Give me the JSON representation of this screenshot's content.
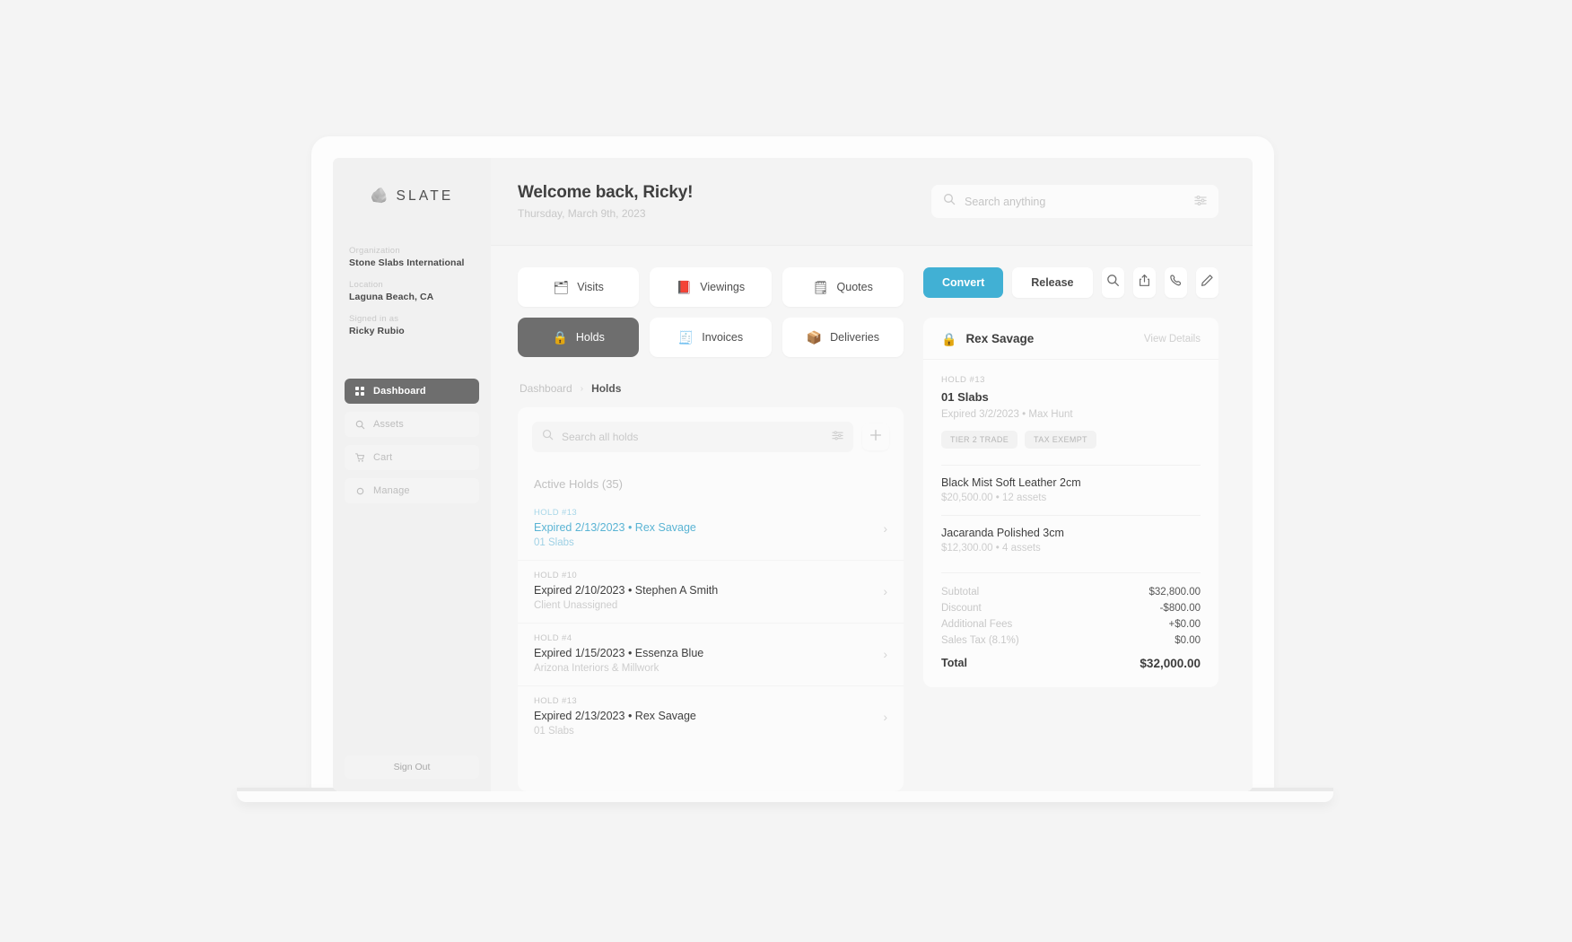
{
  "brand": {
    "mark": "🪨",
    "name": "SLATE"
  },
  "sidebar": {
    "org_label": "Organization",
    "org_value": "Stone Slabs International",
    "location_label": "Location",
    "location_value": "Laguna Beach, CA",
    "signedin_label": "Signed in as",
    "signedin_value": "Ricky Rubio",
    "nav": [
      {
        "label": "Dashboard",
        "icon": "grid-icon",
        "active": true
      },
      {
        "label": "Assets",
        "icon": "search-icon",
        "active": false
      },
      {
        "label": "Cart",
        "icon": "cart-icon",
        "active": false
      },
      {
        "label": "Manage",
        "icon": "gear-icon",
        "active": false
      }
    ],
    "sign_out": "Sign Out"
  },
  "topbar": {
    "title": "Welcome back, Ricky!",
    "subtitle": "Thursday, March 9th, 2023",
    "search_placeholder": "Search anything",
    "search_value": "",
    "filter_icon": "sliders-icon",
    "search_icon": "search-icon"
  },
  "chips": [
    {
      "label": "Visits",
      "emoji": "🗂",
      "active": false
    },
    {
      "label": "Viewings",
      "emoji": "📕",
      "active": false
    },
    {
      "label": "Quotes",
      "emoji": "🗒",
      "active": false
    },
    {
      "label": "Holds",
      "emoji": "🔒",
      "active": true
    },
    {
      "label": "Invoices",
      "emoji": "🧾",
      "active": false
    },
    {
      "label": "Deliveries",
      "emoji": "📦",
      "active": false
    }
  ],
  "breadcrumb": {
    "parent": "Dashboard",
    "separator": "›",
    "current": "Holds"
  },
  "holds_panel": {
    "search_placeholder": "Search all holds",
    "search_value": "",
    "filter_icon": "sliders-icon",
    "add_icon": "plus-icon",
    "section_label": "Active Holds (35)",
    "rows": [
      {
        "id": "HOLD #13",
        "title": "Expired 2/13/2023 • Rex Savage",
        "sub": "01 Slabs",
        "selected": true
      },
      {
        "id": "HOLD #10",
        "title": "Expired 2/10/2023 • Stephen A Smith",
        "sub": "Client Unassigned",
        "selected": false
      },
      {
        "id": "HOLD #4",
        "title": "Expired 1/15/2023 • Essenza Blue",
        "sub": "Arizona Interiors & Millwork",
        "selected": false
      },
      {
        "id": "HOLD #13",
        "title": "Expired 2/13/2023 • Rex Savage",
        "sub": "01 Slabs",
        "selected": false
      }
    ]
  },
  "actions": {
    "convert": "Convert",
    "release": "Release",
    "icons": [
      "search-icon",
      "share-icon",
      "phone-icon",
      "edit-icon"
    ]
  },
  "detail": {
    "lock_icon": "lock-icon",
    "client_name": "Rex Savage",
    "view_details": "View Details",
    "kicker": "HOLD #13",
    "title": "01 Slabs",
    "meta": "Expired 3/2/2023 • Max Hunt",
    "tags": [
      "TIER 2 TRADE",
      "TAX EXEMPT"
    ],
    "line_items": [
      {
        "name": "Black Mist Soft Leather 2cm",
        "sub": "$20,500.00 • 12 assets"
      },
      {
        "name": "Jacaranda Polished 3cm",
        "sub": "$12,300.00 • 4 assets"
      }
    ],
    "totals": [
      {
        "label": "Subtotal",
        "value": "$32,800.00"
      },
      {
        "label": "Discount",
        "value": "-$800.00"
      },
      {
        "label": "Additional Fees",
        "value": "+$0.00"
      },
      {
        "label": "Sales Tax (8.1%)",
        "value": "$0.00"
      }
    ],
    "grand_label": "Total",
    "grand_value": "$32,000.00"
  },
  "colors": {
    "accent": "#41b0d4",
    "active_chip": "#6e6e6e",
    "link": "#5ab4d4"
  }
}
